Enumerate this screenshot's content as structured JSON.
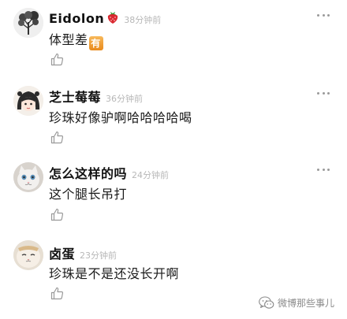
{
  "comments": [
    {
      "username": "Eidolon",
      "badge_icon": "strawberry-icon",
      "time": "38分钟前",
      "text": "体型差",
      "emoji_text": "有",
      "avatar_icon": "tree-avatar"
    },
    {
      "username": "芝士莓莓",
      "time": "36分钟前",
      "text": "珍珠好像驴啊哈哈哈哈喝",
      "avatar_icon": "anime-girl-avatar"
    },
    {
      "username": "怎么这样的吗",
      "time": "24分钟前",
      "text": "这个腿长吊打",
      "avatar_icon": "cat-avatar"
    },
    {
      "username": "卤蛋",
      "time": "23分钟前",
      "text": "珍珠是不是还没长开啊",
      "avatar_icon": "cat-face-avatar"
    }
  ],
  "watermark": {
    "text": "微博那些事儿",
    "icon": "wechat-icon"
  },
  "colors": {
    "username": "#111111",
    "time": "#b7b7b7",
    "body_text": "#1a1a1a",
    "icon_gray": "#9a9a9a"
  }
}
